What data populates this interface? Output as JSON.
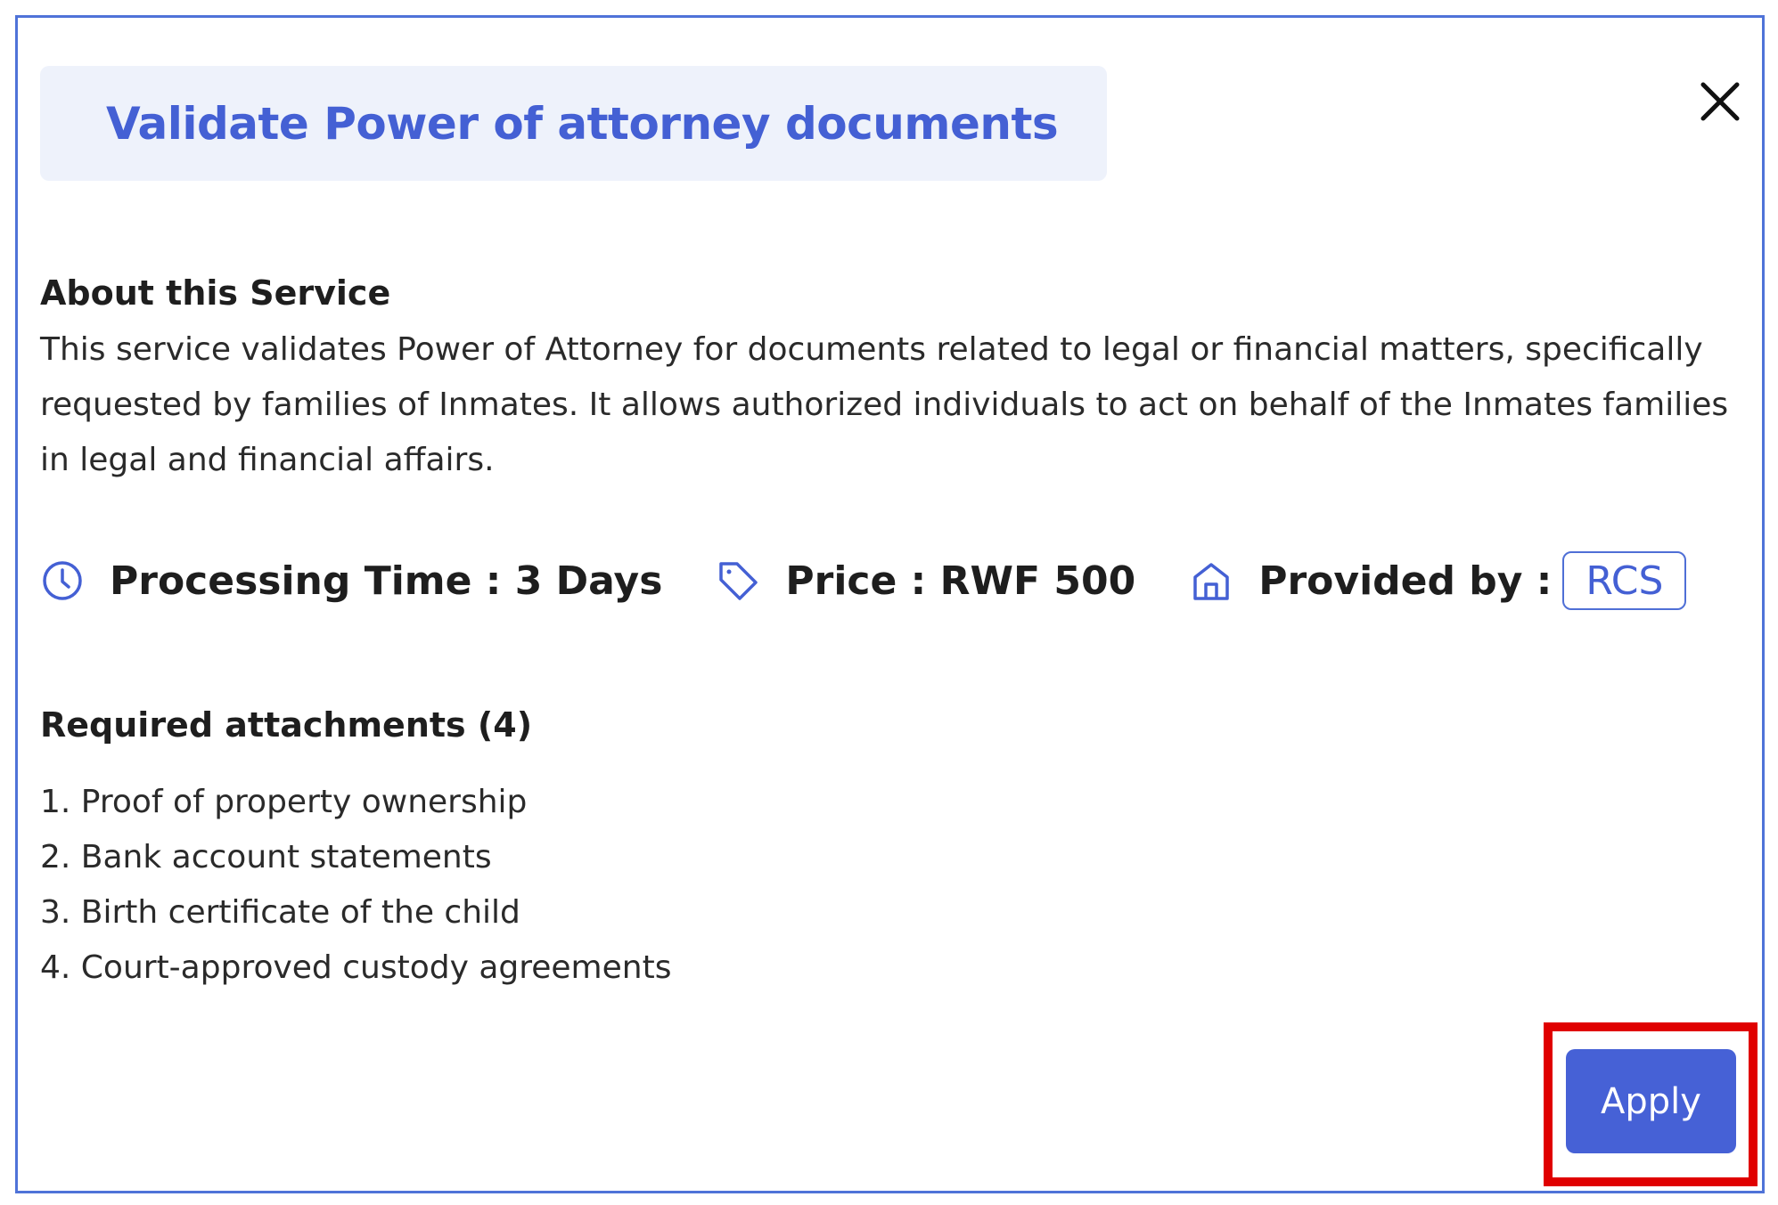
{
  "dialog": {
    "title": "Validate Power of attorney documents",
    "close_icon": "close-icon"
  },
  "about": {
    "heading": "About this Service",
    "text": "This service validates Power of Attorney for documents related to legal or financial matters, specifically requested by families of Inmates. It allows authorized individuals to act on behalf of the Inmates families in legal and financial affairs."
  },
  "meta": {
    "processing_time": {
      "icon": "clock-icon",
      "label": "Processing Time : 3 Days"
    },
    "price": {
      "icon": "tag-icon",
      "label": "Price : RWF 500"
    },
    "provider": {
      "icon": "home-icon",
      "label": "Provided by :",
      "value": "RCS"
    }
  },
  "attachments": {
    "heading": "Required attachments (4)",
    "items": [
      "1. Proof of property ownership",
      "2. Bank account statements",
      "3. Birth certificate of the child",
      "4. Court-approved custody agreements"
    ]
  },
  "actions": {
    "apply_label": "Apply"
  },
  "colors": {
    "accent": "#4661d6",
    "title_bg": "#eef2fb",
    "highlight": "#e00000",
    "frame": "#4f73d8"
  }
}
